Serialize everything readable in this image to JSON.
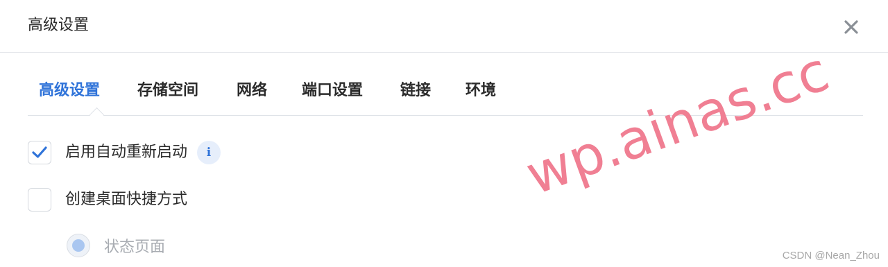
{
  "dialog": {
    "title": "高级设置",
    "close_icon": "close-icon"
  },
  "tabs": [
    {
      "label": "高级设置",
      "active": true
    },
    {
      "label": "存储空间",
      "active": false
    },
    {
      "label": "网络",
      "active": false
    },
    {
      "label": "端口设置",
      "active": false
    },
    {
      "label": "链接",
      "active": false
    },
    {
      "label": "环境",
      "active": false
    }
  ],
  "options": {
    "auto_restart": {
      "label": "启用自动重新启动",
      "checked": true,
      "info_icon": "info-icon"
    },
    "desktop_shortcut": {
      "label": "创建桌面快捷方式",
      "checked": false
    },
    "status_page": {
      "label": "状态页面",
      "selected": true,
      "disabled": true
    }
  },
  "overlay": {
    "watermark": "wp.ainas.cc",
    "credit": "CSDN @Nean_Zhou"
  },
  "colors": {
    "accent": "#2f73d9",
    "watermark": "#f07f93"
  }
}
